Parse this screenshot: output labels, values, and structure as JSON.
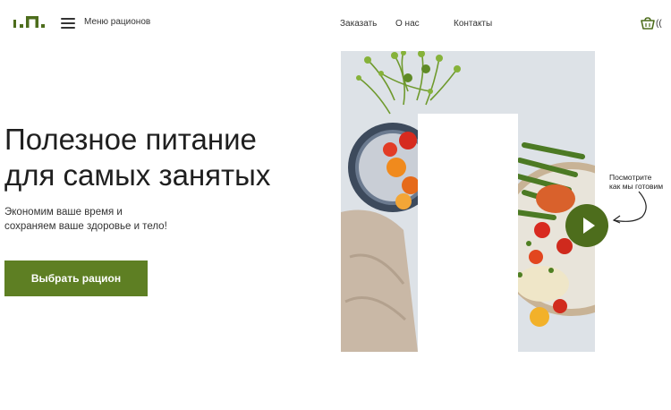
{
  "header": {
    "logo_text": "ı.п.",
    "menu_label": "Меню рационов",
    "nav": [
      "Заказать",
      "О нас",
      "Контакты"
    ],
    "cart_count": "(("
  },
  "hero": {
    "title_line1": "Полезное питание",
    "title_line2": "для самых занятых",
    "subtitle_line1": "Экономим ваше время и",
    "subtitle_line2": "сохраняем ваше здоровье и тело!",
    "cta_label": "Выбрать рацион"
  },
  "video": {
    "caption_line1": "Посмотрите",
    "caption_line2": "как мы готовим"
  },
  "colors": {
    "accent": "#5e7f23",
    "play": "#4d6d1c"
  },
  "icons": [
    "logo",
    "menu-icon",
    "cart-icon",
    "play-icon",
    "arrow-icon"
  ]
}
